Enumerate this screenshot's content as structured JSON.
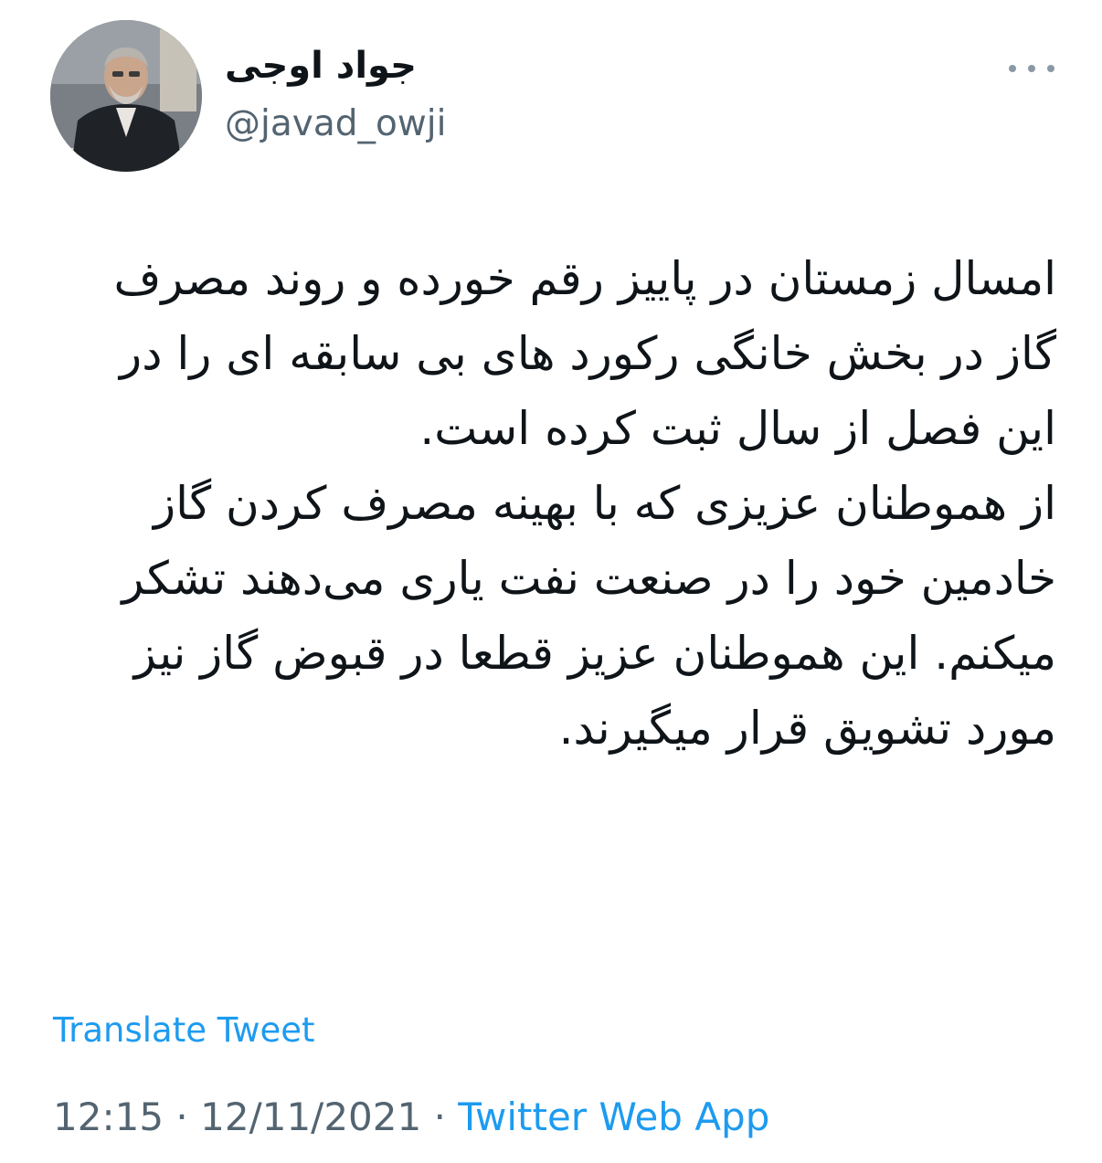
{
  "author": {
    "display_name": "جواد اوجی",
    "handle": "@javad_owji"
  },
  "tweet": {
    "text": "امسال زمستان در پاییز رقم خورده و روند مصرف گاز در بخش خانگی رکورد های بی سابقه ای را در این فصل از سال ثبت کرده است.\nاز هموطنان عزیزی که با بهینه مصرف کردن گاز خادمین خود را در صنعت نفت یاری می‌دهند تشکر میکنم. این هموطنان عزیز قطعا در قبوض گاز نیز مورد تشویق قرار میگیرند.",
    "translate_label": "Translate Tweet"
  },
  "meta": {
    "time": "12:15",
    "separator": "·",
    "date": "12/11/2021",
    "source": "Twitter Web App"
  },
  "icons": {
    "more": "more-horizontal-icon",
    "avatar": "profile-photo"
  },
  "colors": {
    "link": "#1d9bf0",
    "secondary_text": "#536471",
    "primary_text": "#0f1419"
  }
}
